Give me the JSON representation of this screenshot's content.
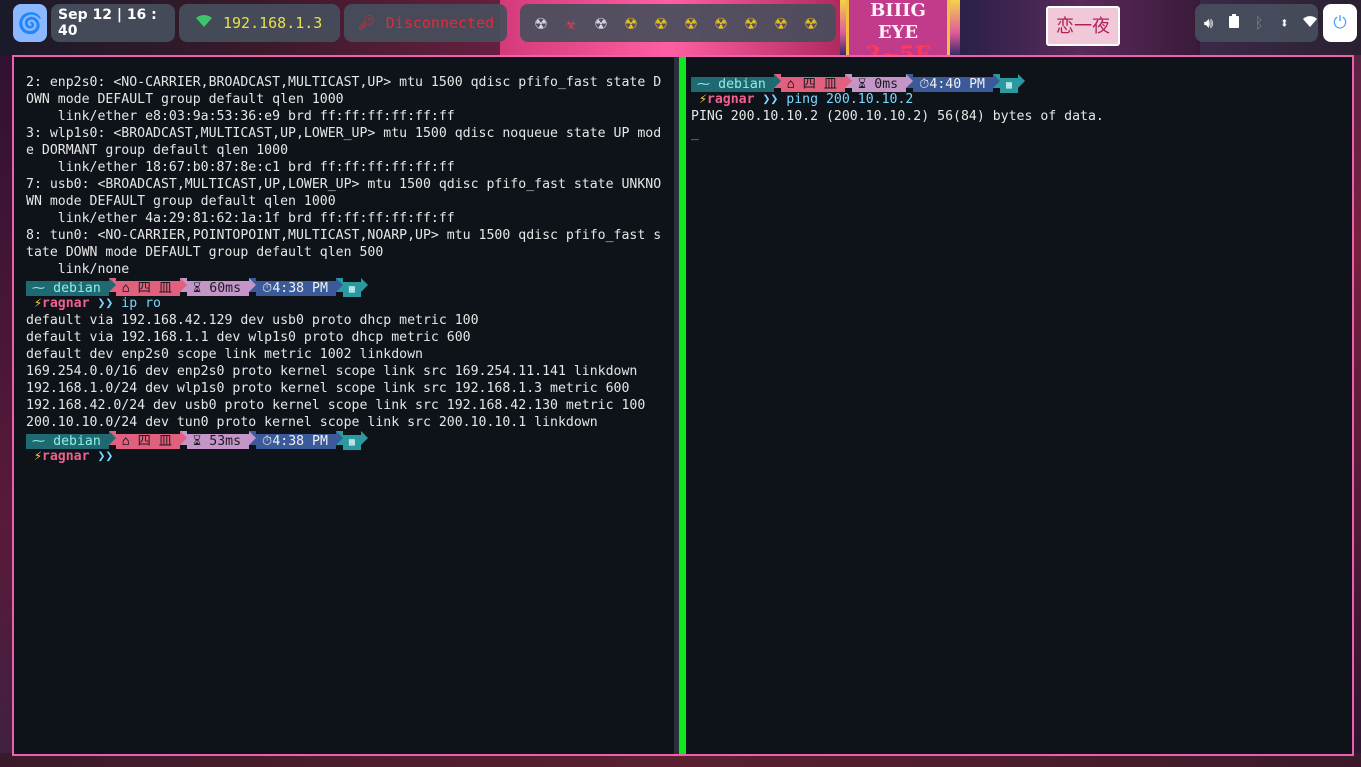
{
  "topbar": {
    "launcher_icon": "debian-swirl-icon",
    "clock": "Sep 12 | 16 : 40",
    "wifi": {
      "icon": "wifi-icon",
      "ip": "192.168.1.3"
    },
    "vpn": {
      "icon": "vpn-key-icon",
      "status": "Disconnected"
    },
    "workspaces": [
      {
        "glyph": "☢",
        "style": "dim"
      },
      {
        "glyph": "☣",
        "style": "red"
      },
      {
        "glyph": "☢",
        "style": "dim"
      },
      {
        "glyph": "☢",
        "style": "yellow"
      },
      {
        "glyph": "☢",
        "style": "yellow"
      },
      {
        "glyph": "☢",
        "style": "yellow"
      },
      {
        "glyph": "☢",
        "style": "yellow"
      },
      {
        "glyph": "☢",
        "style": "yellow"
      },
      {
        "glyph": "☢",
        "style": "yellow"
      },
      {
        "glyph": "☢",
        "style": "yellow"
      }
    ],
    "tray": [
      "volume-icon",
      "battery-icon",
      "bluetooth-off-icon",
      "usb-icon",
      "wifi-icon"
    ],
    "power_icon": "power-icon"
  },
  "wallpaper": {
    "sign_top": "BIIIG EYE",
    "sign_bottom": "3~5F",
    "kanji_sign": "恋一夜"
  },
  "prompt": {
    "host": "debian",
    "dir": "四 皿",
    "user": "ragnar",
    "chevrons": "❯❯"
  },
  "left_pane": {
    "output_a": [
      "2: enp2s0: <NO-CARRIER,BROADCAST,MULTICAST,UP> mtu 1500 qdisc pfifo_fast state D",
      "OWN mode DEFAULT group default qlen 1000",
      "    link/ether e8:03:9a:53:36:e9 brd ff:ff:ff:ff:ff:ff",
      "3: wlp1s0: <BROADCAST,MULTICAST,UP,LOWER_UP> mtu 1500 qdisc noqueue state UP mod",
      "e DORMANT group default qlen 1000",
      "    link/ether 18:67:b0:87:8e:c1 brd ff:ff:ff:ff:ff:ff",
      "7: usb0: <BROADCAST,MULTICAST,UP,LOWER_UP> mtu 1500 qdisc pfifo_fast state UNKNO",
      "WN mode DEFAULT group default qlen 1000",
      "    link/ether 4a:29:81:62:1a:1f brd ff:ff:ff:ff:ff:ff",
      "8: tun0: <NO-CARRIER,POINTOPOINT,MULTICAST,NOARP,UP> mtu 1500 qdisc pfifo_fast s",
      "tate DOWN mode DEFAULT group default qlen 500",
      "    link/none"
    ],
    "prompt1": {
      "elapsed": "60ms",
      "time": "4:38 PM"
    },
    "command1": "ip ro",
    "output_b": [
      "default via 192.168.42.129 dev usb0 proto dhcp metric 100",
      "default via 192.168.1.1 dev wlp1s0 proto dhcp metric 600",
      "default dev enp2s0 scope link metric 1002 linkdown",
      "169.254.0.0/16 dev enp2s0 proto kernel scope link src 169.254.11.141 linkdown",
      "192.168.1.0/24 dev wlp1s0 proto kernel scope link src 192.168.1.3 metric 600",
      "192.168.42.0/24 dev usb0 proto kernel scope link src 192.168.42.130 metric 100",
      "200.10.10.0/24 dev tun0 proto kernel scope link src 200.10.10.1 linkdown"
    ],
    "prompt2": {
      "elapsed": "53ms",
      "time": "4:38 PM"
    }
  },
  "right_pane": {
    "prompt1": {
      "elapsed": "0ms",
      "time": "4:40 PM"
    },
    "command1": "ping 200.10.10.2",
    "output": "PING 200.10.10.2 (200.10.10.2) 56(84) bytes of data.",
    "cursor": "_"
  },
  "colors": {
    "frame_border": "#ee5fae",
    "divider": "#0de820",
    "terminal_bg": "#0e1219"
  }
}
